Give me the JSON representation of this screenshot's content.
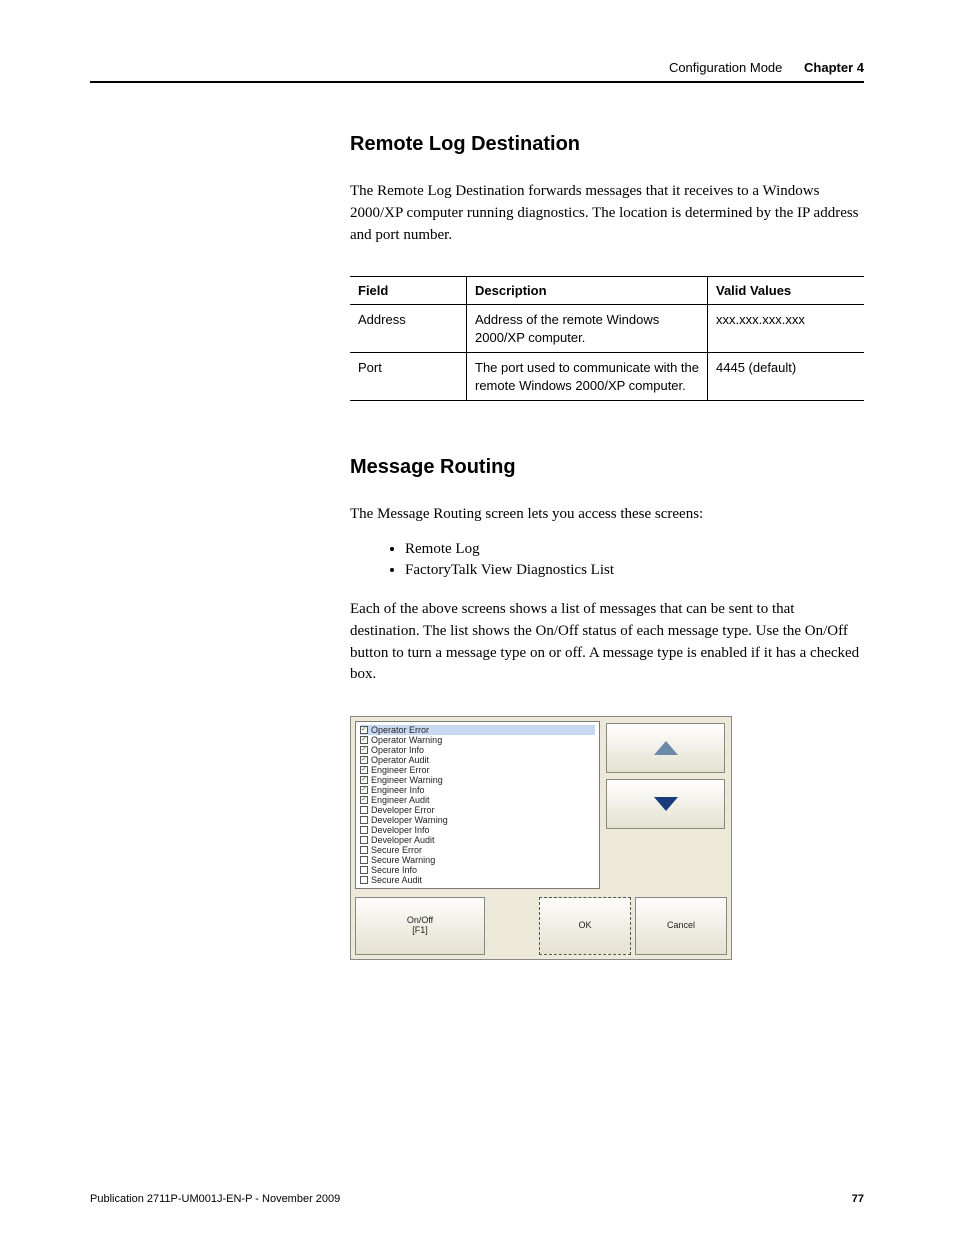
{
  "header": {
    "breadcrumb": "Configuration Mode",
    "chapter": "Chapter 4"
  },
  "section1": {
    "title": "Remote Log Destination",
    "body": "The Remote Log Destination forwards messages that it receives to a Windows 2000/XP computer running diagnostics. The location is determined by the IP address and port number."
  },
  "table": {
    "headers": {
      "field": "Field",
      "description": "Description",
      "values": "Valid Values"
    },
    "rows": [
      {
        "field": "Address",
        "description": "Address of the remote Windows 2000/XP computer.",
        "values": "xxx.xxx.xxx.xxx"
      },
      {
        "field": "Port",
        "description": "The port used to communicate with the remote Windows 2000/XP computer.",
        "values": "4445 (default)"
      }
    ]
  },
  "section2": {
    "title": "Message Routing",
    "intro": "The Message Routing screen lets you access these screens:",
    "bullets": [
      "Remote Log",
      "FactoryTalk View Diagnostics List"
    ],
    "body2": "Each of the above screens shows a list of messages that can be sent to that destination. The list shows the On/Off status of each message type. Use the On/Off button to turn a message type on or off. A message type is enabled if it has a checked box."
  },
  "ui": {
    "items": [
      {
        "label": "Operator Error",
        "checked": true,
        "selected": true
      },
      {
        "label": "Operator Warning",
        "checked": true,
        "selected": false
      },
      {
        "label": "Operator Info",
        "checked": true,
        "selected": false
      },
      {
        "label": "Operator Audit",
        "checked": true,
        "selected": false
      },
      {
        "label": "Engineer Error",
        "checked": true,
        "selected": false
      },
      {
        "label": "Engineer Warning",
        "checked": true,
        "selected": false
      },
      {
        "label": "Engineer Info",
        "checked": true,
        "selected": false
      },
      {
        "label": "Engineer Audit",
        "checked": true,
        "selected": false
      },
      {
        "label": "Developer Error",
        "checked": false,
        "selected": false
      },
      {
        "label": "Developer Warning",
        "checked": false,
        "selected": false
      },
      {
        "label": "Developer Info",
        "checked": false,
        "selected": false
      },
      {
        "label": "Developer Audit",
        "checked": false,
        "selected": false
      },
      {
        "label": "Secure Error",
        "checked": false,
        "selected": false
      },
      {
        "label": "Secure Warning",
        "checked": false,
        "selected": false
      },
      {
        "label": "Secure Info",
        "checked": false,
        "selected": false
      },
      {
        "label": "Secure Audit",
        "checked": false,
        "selected": false
      }
    ],
    "checkmark": "✓",
    "onoff_label": "On/Off\n[F1]",
    "ok_label": "OK",
    "cancel_label": "Cancel"
  },
  "footer": {
    "publication": "Publication 2711P-UM001J-EN-P - November 2009",
    "page": "77"
  }
}
